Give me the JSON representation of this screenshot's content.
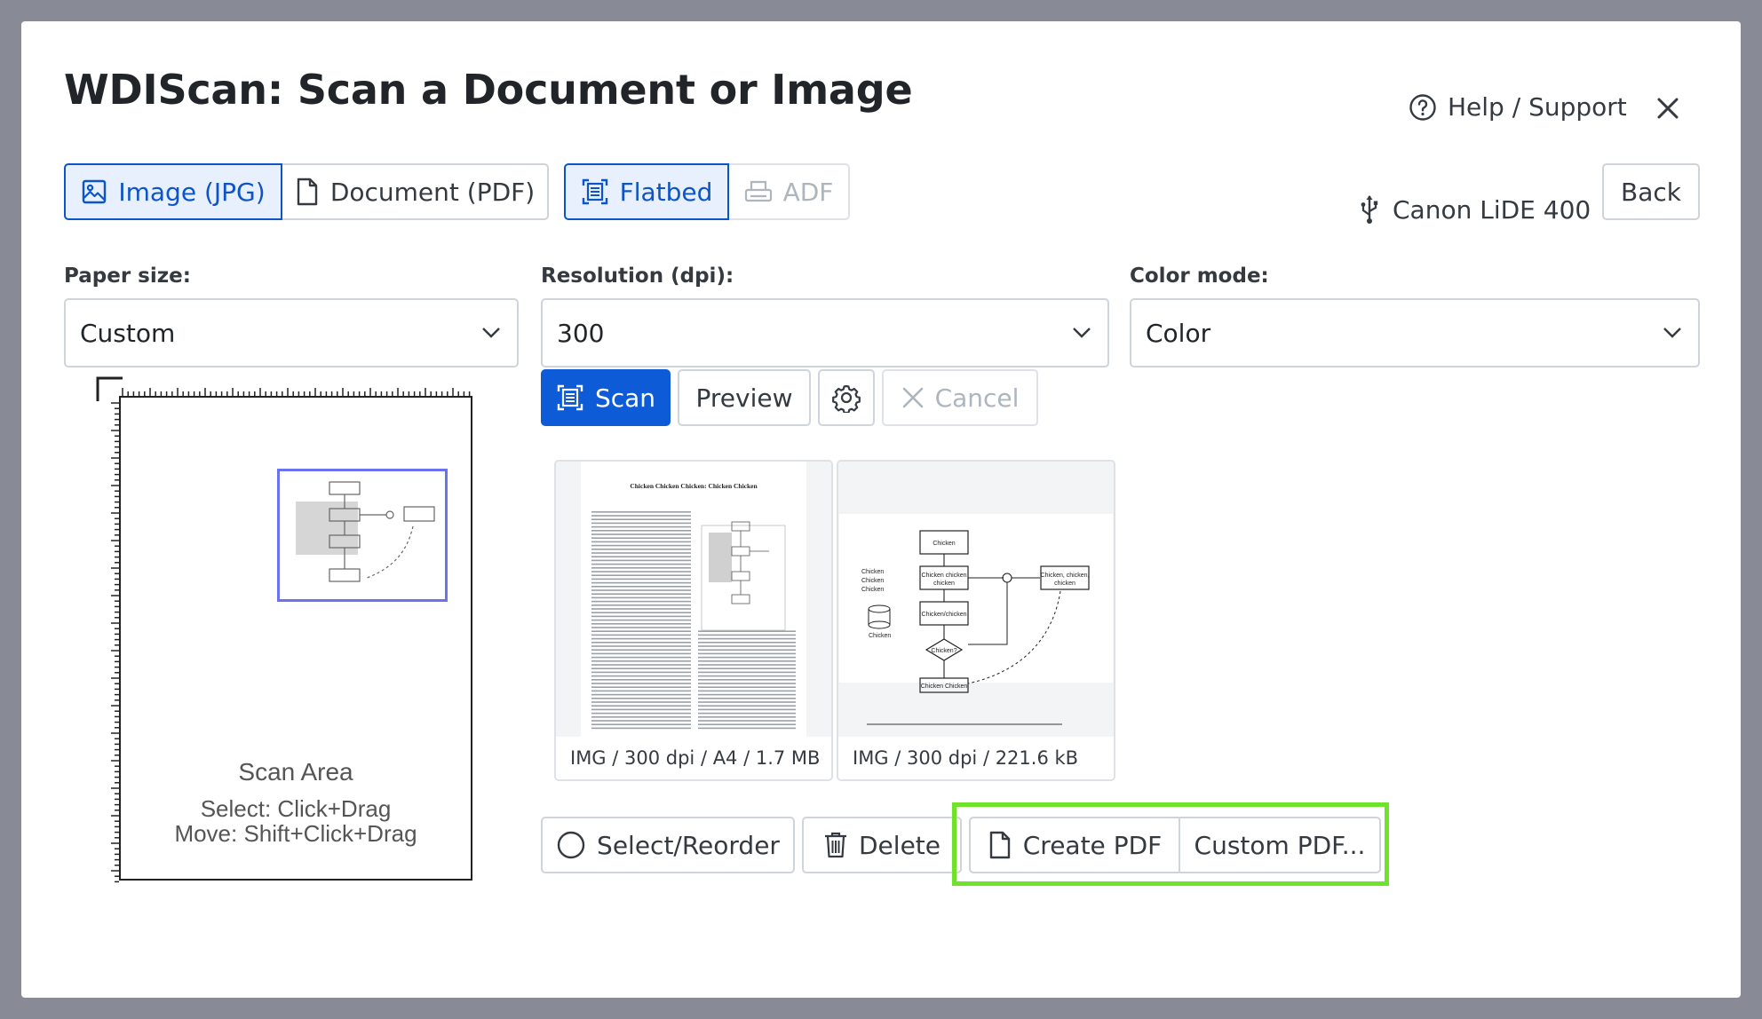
{
  "dialog": {
    "title": "WDIScan: Scan a Document or Image",
    "help_label": "Help / Support"
  },
  "format_toggle": [
    {
      "label": "Image (JPG)",
      "icon": "image-icon",
      "active": true
    },
    {
      "label": "Document (PDF)",
      "icon": "document-icon",
      "active": false
    }
  ],
  "source_toggle": [
    {
      "label": "Flatbed",
      "icon": "flatbed-icon",
      "active": true
    },
    {
      "label": "ADF",
      "icon": "printer-icon",
      "active": false,
      "disabled": true
    }
  ],
  "device": {
    "name": "Canon LiDE 400",
    "icon": "usb-icon"
  },
  "back_label": "Back",
  "settings": {
    "paper_size": {
      "label": "Paper size:",
      "value": "Custom"
    },
    "resolution": {
      "label": "Resolution (dpi):",
      "value": "300"
    },
    "color_mode": {
      "label": "Color mode:",
      "value": "Color"
    }
  },
  "actions": {
    "scan": "Scan",
    "preview": "Preview",
    "cancel": "Cancel"
  },
  "scan_area": {
    "title": "Scan Area",
    "hint_select": "Select: Click+Drag",
    "hint_move": "Move: Shift+Click+Drag"
  },
  "thumbnails": [
    {
      "caption": "IMG / 300 dpi / A4 / 1.7 MB",
      "doc_title": "Chicken Chicken Chicken: Chicken Chicken"
    },
    {
      "caption": "IMG / 300 dpi / 221.6 kB"
    }
  ],
  "bottom_actions": {
    "select_reorder": "Select/Reorder",
    "delete": "Delete",
    "create_pdf": "Create PDF",
    "custom_pdf": "Custom PDF..."
  },
  "colors": {
    "primary": "#0d5bd7",
    "highlight": "#6ee32a",
    "selection": "#6a72f0"
  }
}
